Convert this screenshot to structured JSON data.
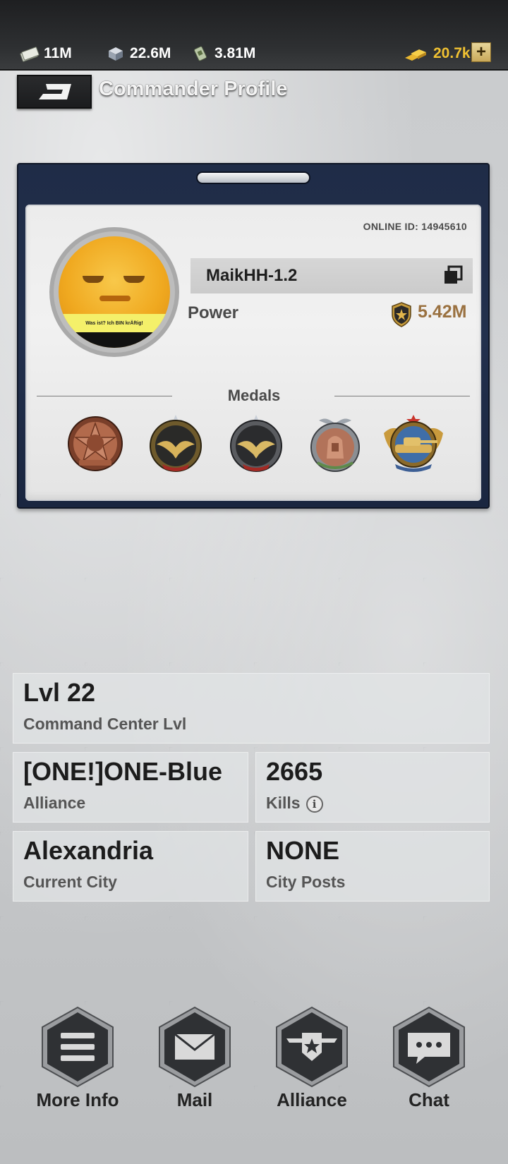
{
  "resources": {
    "cash": "11M",
    "steel": "22.6M",
    "oil": "3.81M",
    "gold": "20.7k",
    "add_label": "+"
  },
  "header": {
    "title": "Commander Profile"
  },
  "profile": {
    "online_id": "ONLINE ID: 14945610",
    "name": "MaikHH-1.2",
    "power_label": "Power",
    "power_value": "5.42M",
    "avatar_caption": "Was ist? Ich BIN krÄftig!"
  },
  "medals": {
    "title": "Medals",
    "items": [
      "bronze-star-medal",
      "eagle-medal-gold",
      "eagle-medal-silver",
      "sphinx-medal",
      "tank-medal"
    ]
  },
  "stats": {
    "command_center": {
      "value": "Lvl 22",
      "label": "Command Center Lvl"
    },
    "alliance": {
      "value": "[ONE!]ONE-Blue",
      "label": "Alliance"
    },
    "kills": {
      "value": "2665",
      "label": "Kills"
    },
    "city": {
      "value": "Alexandria",
      "label": "Current City"
    },
    "city_posts": {
      "value": "NONE",
      "label": "City Posts"
    }
  },
  "actions": [
    {
      "label": "More Info",
      "icon": "menu-icon"
    },
    {
      "label": "Mail",
      "icon": "mail-icon"
    },
    {
      "label": "Alliance",
      "icon": "alliance-icon"
    },
    {
      "label": "Chat",
      "icon": "chat-icon"
    }
  ],
  "colors": {
    "card_frame": "#1f2c47",
    "power_value": "#9a7140",
    "gold": "#f1c232"
  }
}
